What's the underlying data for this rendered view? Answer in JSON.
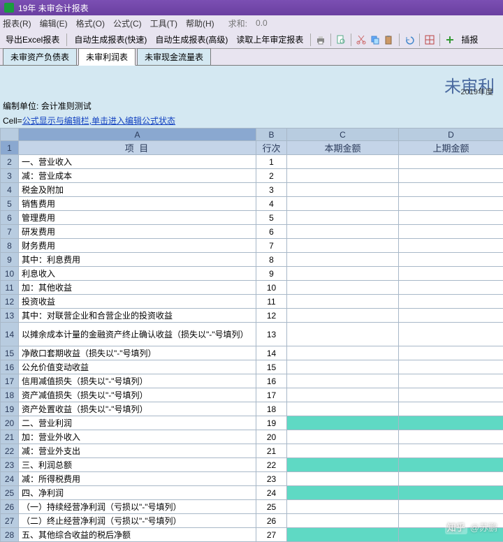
{
  "window": {
    "title": "19年 未审会计报表"
  },
  "menu": {
    "items": [
      "报表(R)",
      "编辑(E)",
      "格式(O)",
      "公式(C)",
      "工具(T)",
      "帮助(H)"
    ],
    "sum_label": "求和:",
    "sum_value": "0.0"
  },
  "toolbar": {
    "export": "导出Excel报表",
    "autogen_fast": "自动生成报表(快速)",
    "autogen_adv": "自动生成报表(高级)",
    "read_prev": "读取上年审定报表",
    "insert": "插报"
  },
  "tabs": {
    "items": [
      "未审资产负债表",
      "未审利润表",
      "未审现金流量表"
    ],
    "active": 1
  },
  "title_area": {
    "big": "未审利",
    "year": "2019年度"
  },
  "unit_row": {
    "label": "编制单位:",
    "value": "会计准则测试"
  },
  "cell_row": {
    "label": "Cell=",
    "formula": "公式显示与编辑栏,单击进入编辑公式状态"
  },
  "columns": {
    "A": "A",
    "B": "B",
    "C": "C",
    "D": "D"
  },
  "headers": {
    "A": "项       目",
    "B": "行次",
    "C": "本期金额",
    "D": "上期金额"
  },
  "rows": [
    {
      "n": 2,
      "a": "一、营业收入",
      "b": "1",
      "hl": false
    },
    {
      "n": 3,
      "a": "    减：营业成本",
      "b": "2",
      "hl": false
    },
    {
      "n": 4,
      "a": "        税金及附加",
      "b": "3",
      "hl": false
    },
    {
      "n": 5,
      "a": "        销售费用",
      "b": "4",
      "hl": false
    },
    {
      "n": 6,
      "a": "        管理费用",
      "b": "5",
      "hl": false
    },
    {
      "n": 7,
      "a": "        研发费用",
      "b": "6",
      "hl": false
    },
    {
      "n": 8,
      "a": "        财务费用",
      "b": "7",
      "hl": false
    },
    {
      "n": 9,
      "a": "        其中：利息费用",
      "b": "8",
      "hl": false
    },
    {
      "n": 10,
      "a": "              利息收入",
      "b": "9",
      "hl": false
    },
    {
      "n": 11,
      "a": "    加：其他收益",
      "b": "10",
      "hl": false
    },
    {
      "n": 12,
      "a": "        投资收益",
      "b": "11",
      "hl": false
    },
    {
      "n": 13,
      "a": "        其中：对联营企业和合营企业的投资收益",
      "b": "12",
      "hl": false
    },
    {
      "n": 14,
      "a": "        以摊余成本计量的金融资产终止确认收益（损失以\"-\"号填列）",
      "b": "13",
      "hl": false,
      "tall": true
    },
    {
      "n": 15,
      "a": "        净敞口套期收益（损失以\"-\"号填列）",
      "b": "14",
      "hl": false
    },
    {
      "n": 16,
      "a": "        公允价值变动收益",
      "b": "15",
      "hl": false
    },
    {
      "n": 17,
      "a": "        信用减值损失（损失以\"-\"号填列）",
      "b": "16",
      "hl": false
    },
    {
      "n": 18,
      "a": "        资产减值损失（损失以\"-\"号填列）",
      "b": "17",
      "hl": false
    },
    {
      "n": 19,
      "a": "        资产处置收益（损失以\"-\"号填列）",
      "b": "18",
      "hl": false
    },
    {
      "n": 20,
      "a": "二、营业利润",
      "b": "19",
      "hl": true
    },
    {
      "n": 21,
      "a": "    加：营业外收入",
      "b": "20",
      "hl": false
    },
    {
      "n": 22,
      "a": "    减：营业外支出",
      "b": "21",
      "hl": false
    },
    {
      "n": 23,
      "a": "三、利润总额",
      "b": "22",
      "hl": true
    },
    {
      "n": 24,
      "a": "    减：所得税费用",
      "b": "23",
      "hl": false
    },
    {
      "n": 25,
      "a": "四、净利润",
      "b": "24",
      "hl": true
    },
    {
      "n": 26,
      "a": "    （一）持续经营净利润（亏损以\"-\"号填列）",
      "b": "25",
      "hl": false
    },
    {
      "n": 27,
      "a": "    （二）终止经营净利润（亏损以\"-\"号填列）",
      "b": "26",
      "hl": false
    },
    {
      "n": 28,
      "a": "五、其他综合收益的税后净额",
      "b": "27",
      "hl": true
    }
  ],
  "watermark": {
    "site": "知乎",
    "user": "@苏鹏"
  }
}
